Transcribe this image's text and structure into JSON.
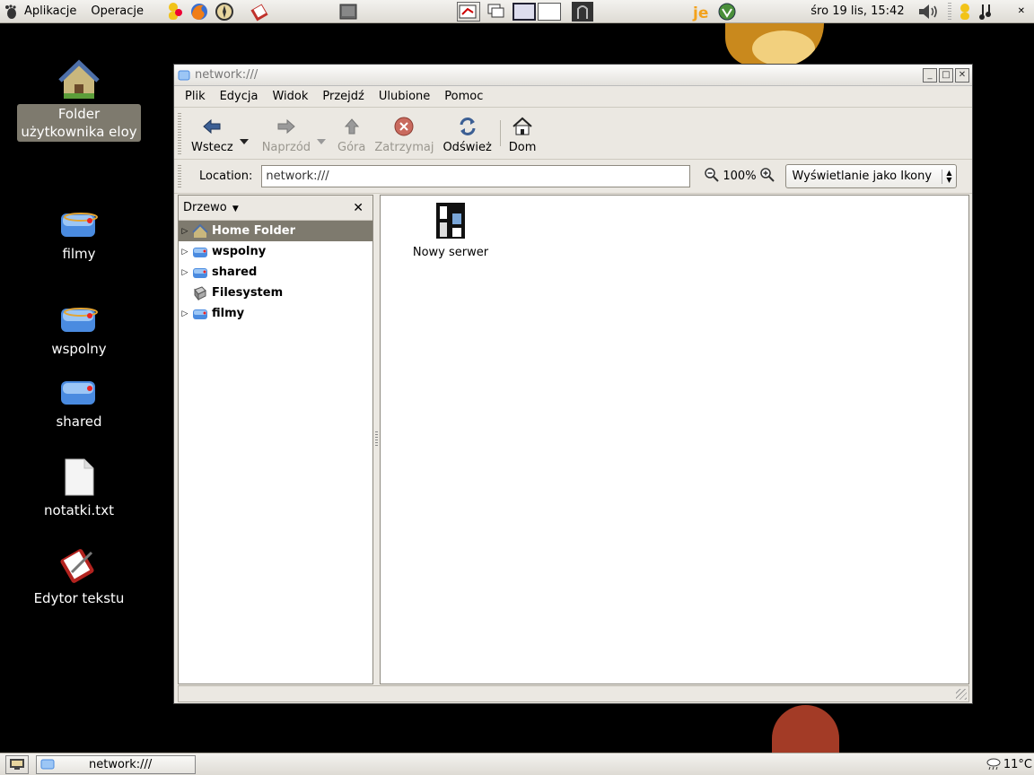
{
  "top_panel": {
    "menu_applications": "Aplikacje",
    "menu_operations": "Operacje",
    "clock": "śro 19 lis, 15:42"
  },
  "desktop_icons": {
    "home_folder": "Folder\nużytkownika eloy",
    "filmy": "filmy",
    "wspolny": "wspolny",
    "shared": "shared",
    "notatki": "notatki.txt",
    "editor": "Edytor tekstu"
  },
  "window": {
    "title": "network:///",
    "menu": {
      "file": "Plik",
      "edit": "Edycja",
      "view": "Widok",
      "go": "Przejdź",
      "bookmarks": "Ulubione",
      "help": "Pomoc"
    },
    "toolbar": {
      "back": "Wstecz",
      "forward": "Naprzód",
      "up": "Góra",
      "stop": "Zatrzymaj",
      "reload": "Odśwież",
      "home": "Dom"
    },
    "location": {
      "label": "Location:",
      "value": "network:///",
      "zoom": "100%",
      "view_mode": "Wyświetlanie jako Ikony"
    },
    "sidebar": {
      "title": "Drzewo",
      "items": [
        {
          "label": "Home Folder",
          "selected": true,
          "expandable": true
        },
        {
          "label": "wspolny",
          "selected": false,
          "expandable": true
        },
        {
          "label": "shared",
          "selected": false,
          "expandable": true
        },
        {
          "label": "Filesystem",
          "selected": false,
          "expandable": false
        },
        {
          "label": "filmy",
          "selected": false,
          "expandable": true
        }
      ]
    },
    "content": {
      "items": [
        {
          "label": "Nowy serwer",
          "icon": "network-server-icon"
        }
      ]
    }
  },
  "bottom_panel": {
    "task_label": "network:///",
    "temperature": "11°C"
  },
  "colors": {
    "selection": "#7e7a6e",
    "panel": "#e8e6e1",
    "desktop": "#000000"
  }
}
